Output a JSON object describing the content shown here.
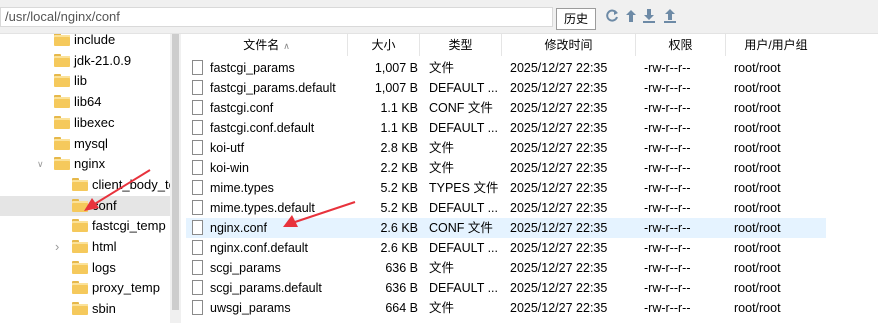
{
  "path": {
    "value": "/usr/local/nginx/conf"
  },
  "toolbar": {
    "history_label": "历史",
    "icons": [
      "refresh-icon",
      "go-up-icon",
      "download-icon",
      "upload-icon"
    ]
  },
  "tree": {
    "items": [
      {
        "label": "include",
        "indent": 1,
        "expanded": false,
        "selected": false
      },
      {
        "label": "jdk-21.0.9",
        "indent": 1,
        "expanded": false,
        "selected": false
      },
      {
        "label": "lib",
        "indent": 1,
        "expanded": false,
        "selected": false
      },
      {
        "label": "lib64",
        "indent": 1,
        "expanded": false,
        "selected": false
      },
      {
        "label": "libexec",
        "indent": 1,
        "expanded": false,
        "selected": false
      },
      {
        "label": "mysql",
        "indent": 1,
        "expanded": false,
        "selected": false
      },
      {
        "label": "nginx",
        "indent": 1,
        "expanded": true,
        "selected": false
      },
      {
        "label": "client_body_te",
        "indent": 2,
        "expanded": false,
        "selected": false
      },
      {
        "label": "conf",
        "indent": 2,
        "expanded": false,
        "selected": true
      },
      {
        "label": "fastcgi_temp",
        "indent": 2,
        "expanded": false,
        "selected": false
      },
      {
        "label": "html",
        "indent": 2,
        "expanded": false,
        "collapsed_arrow": true,
        "selected": false
      },
      {
        "label": "logs",
        "indent": 2,
        "expanded": false,
        "selected": false
      },
      {
        "label": "proxy_temp",
        "indent": 2,
        "expanded": false,
        "selected": false
      },
      {
        "label": "sbin",
        "indent": 2,
        "expanded": false,
        "selected": false
      }
    ]
  },
  "list": {
    "columns": [
      "文件名",
      "大小",
      "类型",
      "修改时间",
      "权限",
      "用户/用户组"
    ],
    "rows": [
      {
        "name": "fastcgi_params",
        "size": "1,007 B",
        "type": "文件",
        "mtime": "2025/12/27 22:35",
        "perm": "-rw-r--r--",
        "owner": "root/root",
        "selected": false
      },
      {
        "name": "fastcgi_params.default",
        "size": "1,007 B",
        "type": "DEFAULT ...",
        "mtime": "2025/12/27 22:35",
        "perm": "-rw-r--r--",
        "owner": "root/root",
        "selected": false
      },
      {
        "name": "fastcgi.conf",
        "size": "1.1 KB",
        "type": "CONF 文件",
        "mtime": "2025/12/27 22:35",
        "perm": "-rw-r--r--",
        "owner": "root/root",
        "selected": false
      },
      {
        "name": "fastcgi.conf.default",
        "size": "1.1 KB",
        "type": "DEFAULT ...",
        "mtime": "2025/12/27 22:35",
        "perm": "-rw-r--r--",
        "owner": "root/root",
        "selected": false
      },
      {
        "name": "koi-utf",
        "size": "2.8 KB",
        "type": "文件",
        "mtime": "2025/12/27 22:35",
        "perm": "-rw-r--r--",
        "owner": "root/root",
        "selected": false
      },
      {
        "name": "koi-win",
        "size": "2.2 KB",
        "type": "文件",
        "mtime": "2025/12/27 22:35",
        "perm": "-rw-r--r--",
        "owner": "root/root",
        "selected": false
      },
      {
        "name": "mime.types",
        "size": "5.2 KB",
        "type": "TYPES 文件",
        "mtime": "2025/12/27 22:35",
        "perm": "-rw-r--r--",
        "owner": "root/root",
        "selected": false
      },
      {
        "name": "mime.types.default",
        "size": "5.2 KB",
        "type": "DEFAULT ...",
        "mtime": "2025/12/27 22:35",
        "perm": "-rw-r--r--",
        "owner": "root/root",
        "selected": false
      },
      {
        "name": "nginx.conf",
        "size": "2.6 KB",
        "type": "CONF 文件",
        "mtime": "2025/12/27 22:35",
        "perm": "-rw-r--r--",
        "owner": "root/root",
        "selected": true
      },
      {
        "name": "nginx.conf.default",
        "size": "2.6 KB",
        "type": "DEFAULT ...",
        "mtime": "2025/12/27 22:35",
        "perm": "-rw-r--r--",
        "owner": "root/root",
        "selected": false
      },
      {
        "name": "scgi_params",
        "size": "636 B",
        "type": "文件",
        "mtime": "2025/12/27 22:35",
        "perm": "-rw-r--r--",
        "owner": "root/root",
        "selected": false
      },
      {
        "name": "scgi_params.default",
        "size": "636 B",
        "type": "DEFAULT ...",
        "mtime": "2025/12/27 22:35",
        "perm": "-rw-r--r--",
        "owner": "root/root",
        "selected": false
      },
      {
        "name": "uwsgi_params",
        "size": "664 B",
        "type": "文件",
        "mtime": "2025/12/27 22:35",
        "perm": "-rw-r--r--",
        "owner": "root/root",
        "selected": false
      }
    ]
  },
  "colors": {
    "selected_row": "#e5f3ff",
    "selected_tree": "#e5e5e5",
    "annotation_arrow": "#e8323c",
    "folder": "#f5c95c"
  }
}
